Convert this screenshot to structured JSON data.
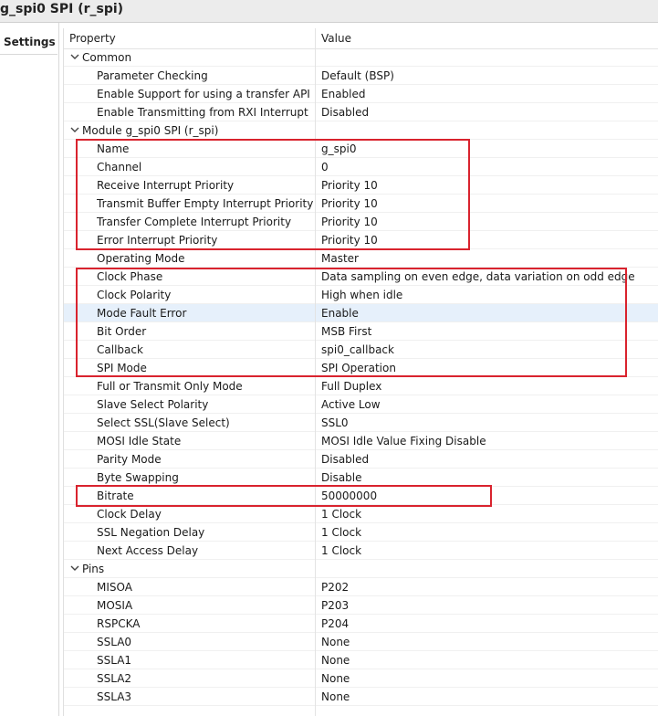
{
  "window": {
    "title": "g_spi0 SPI (r_spi)"
  },
  "tabs": {
    "settings": "Settings"
  },
  "table": {
    "headers": {
      "property": "Property",
      "value": "Value"
    },
    "rows": [
      {
        "type": "group",
        "property": "Common",
        "value": ""
      },
      {
        "type": "child",
        "property": "Parameter Checking",
        "value": "Default (BSP)"
      },
      {
        "type": "child",
        "property": "Enable Support for using a transfer API",
        "value": "Enabled"
      },
      {
        "type": "child",
        "property": "Enable Transmitting from RXI Interrupt",
        "value": "Disabled"
      },
      {
        "type": "group",
        "property": "Module g_spi0 SPI (r_spi)",
        "value": ""
      },
      {
        "type": "child",
        "property": "Name",
        "value": "g_spi0"
      },
      {
        "type": "child",
        "property": "Channel",
        "value": "0"
      },
      {
        "type": "child",
        "property": "Receive Interrupt Priority",
        "value": "Priority 10"
      },
      {
        "type": "child",
        "property": "Transmit Buffer Empty Interrupt Priority",
        "value": "Priority 10"
      },
      {
        "type": "child",
        "property": "Transfer Complete Interrupt Priority",
        "value": "Priority 10"
      },
      {
        "type": "child",
        "property": "Error Interrupt Priority",
        "value": "Priority 10"
      },
      {
        "type": "child",
        "property": "Operating Mode",
        "value": "Master"
      },
      {
        "type": "child",
        "property": "Clock Phase",
        "value": "Data sampling on even edge, data variation on odd edge"
      },
      {
        "type": "child",
        "property": "Clock Polarity",
        "value": "High when idle"
      },
      {
        "type": "child",
        "property": "Mode Fault Error",
        "value": "Enable",
        "selected": true
      },
      {
        "type": "child",
        "property": "Bit Order",
        "value": "MSB First"
      },
      {
        "type": "child",
        "property": "Callback",
        "value": "spi0_callback"
      },
      {
        "type": "child",
        "property": "SPI Mode",
        "value": "SPI Operation"
      },
      {
        "type": "child",
        "property": "Full or Transmit Only Mode",
        "value": "Full Duplex"
      },
      {
        "type": "child",
        "property": "Slave Select Polarity",
        "value": "Active Low"
      },
      {
        "type": "child",
        "property": "Select SSL(Slave Select)",
        "value": "SSL0"
      },
      {
        "type": "child",
        "property": "MOSI Idle State",
        "value": "MOSI Idle Value Fixing Disable"
      },
      {
        "type": "child",
        "property": "Parity Mode",
        "value": "Disabled"
      },
      {
        "type": "child",
        "property": "Byte Swapping",
        "value": "Disable"
      },
      {
        "type": "child",
        "property": "Bitrate",
        "value": "50000000"
      },
      {
        "type": "child",
        "property": "Clock Delay",
        "value": "1 Clock"
      },
      {
        "type": "child",
        "property": "SSL Negation Delay",
        "value": "1 Clock"
      },
      {
        "type": "child",
        "property": "Next Access Delay",
        "value": "1 Clock"
      },
      {
        "type": "group",
        "property": "Pins",
        "value": ""
      },
      {
        "type": "child",
        "property": "MISOA",
        "value": "P202"
      },
      {
        "type": "child",
        "property": "MOSIA",
        "value": "P203"
      },
      {
        "type": "child",
        "property": "RSPCKA",
        "value": "P204"
      },
      {
        "type": "child",
        "property": "SSLA0",
        "value": "None"
      },
      {
        "type": "child",
        "property": "SSLA1",
        "value": "None"
      },
      {
        "type": "child",
        "property": "SSLA2",
        "value": "None"
      },
      {
        "type": "child",
        "property": "SSLA3",
        "value": "None"
      }
    ]
  },
  "colors": {
    "highlight": "#d9232e",
    "selection": "#e6f0fb"
  }
}
